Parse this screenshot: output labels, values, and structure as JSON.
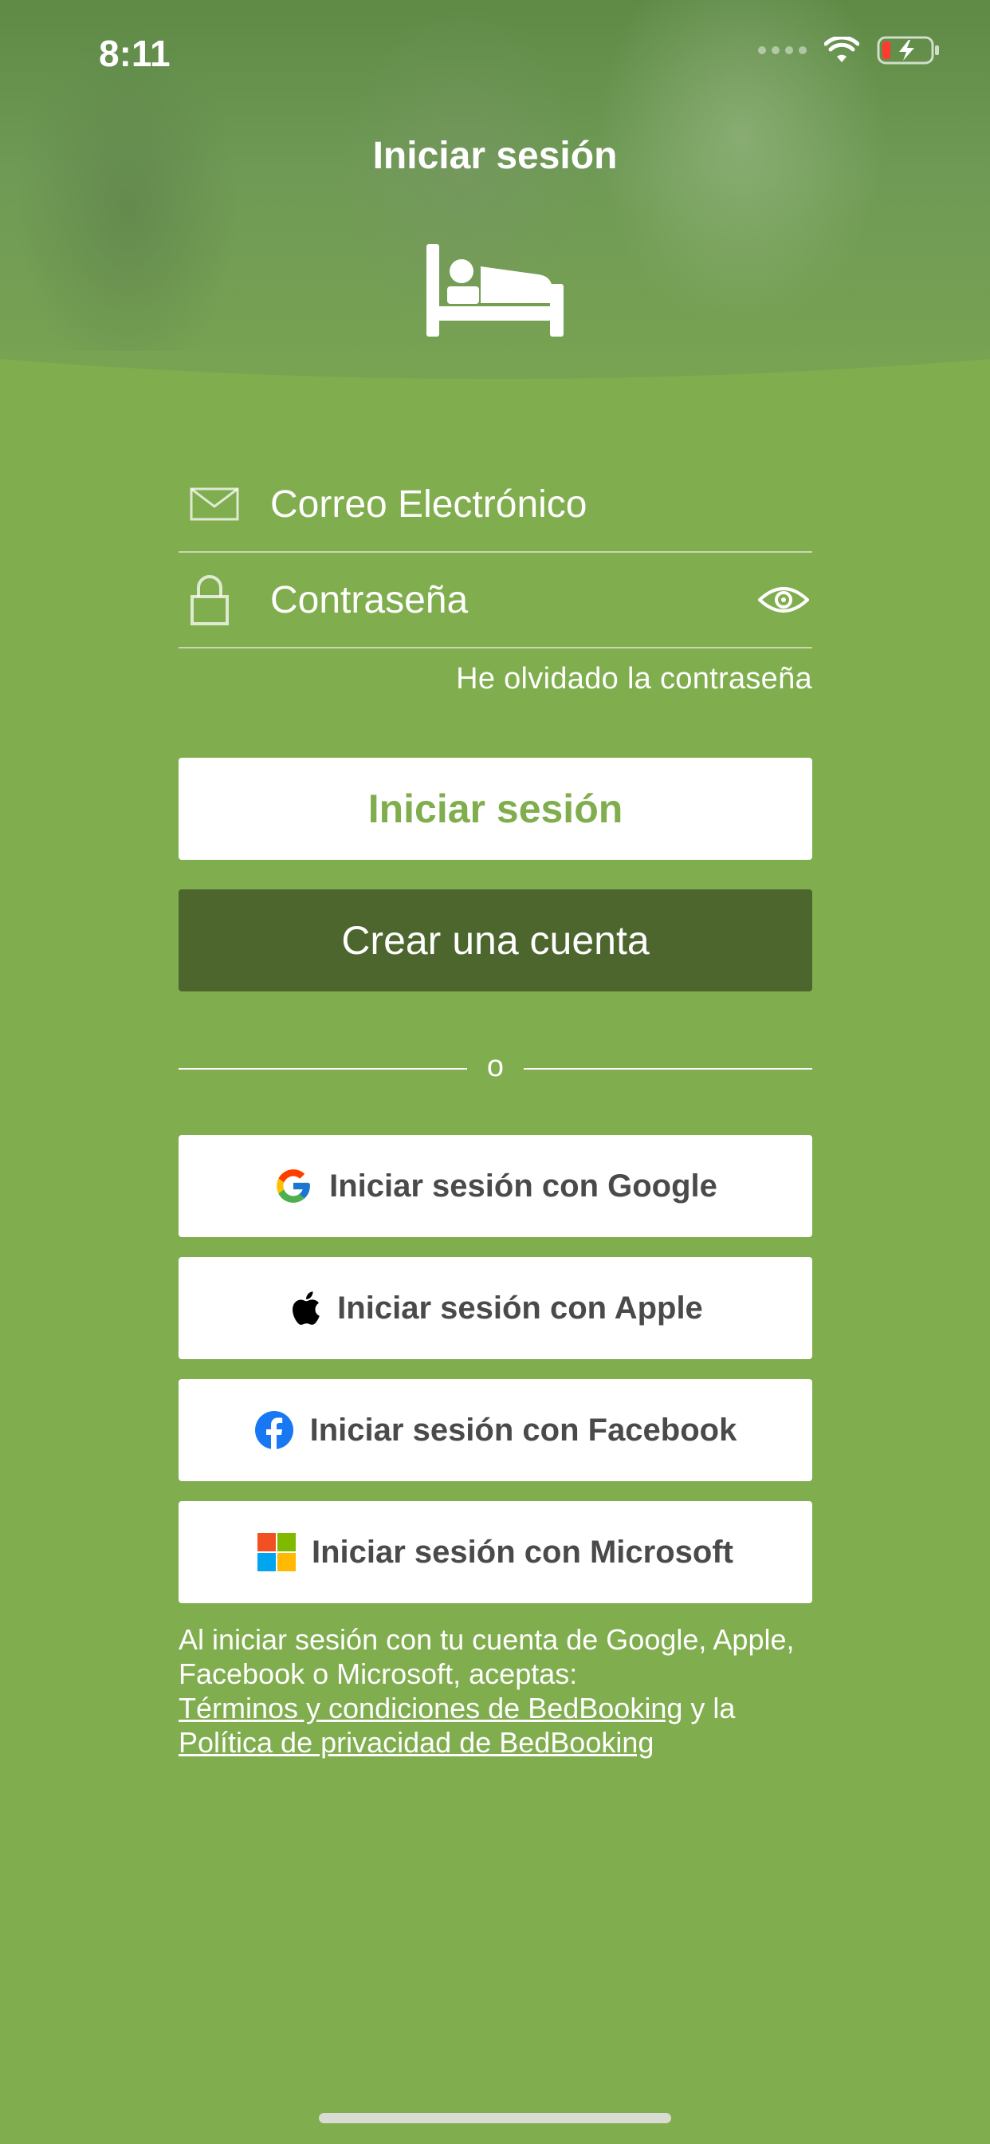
{
  "status_bar": {
    "time": "8:11"
  },
  "header": {
    "title": "Iniciar sesión"
  },
  "form": {
    "email_placeholder": "Correo Electrónico",
    "password_placeholder": "Contraseña",
    "forgot_password": "He olvidado la contraseña"
  },
  "buttons": {
    "login": "Iniciar sesión",
    "create_account": "Crear una cuenta"
  },
  "divider_text": "o",
  "social": {
    "google": "Iniciar sesión con Google",
    "apple": "Iniciar sesión con Apple",
    "facebook": "Iniciar sesión con Facebook",
    "microsoft": "Iniciar sesión con Microsoft"
  },
  "legal": {
    "text_part1": "Al iniciar sesión con tu cuenta de Google, Apple, Facebook o Microsoft, aceptas:",
    "terms_link": "Términos y condiciones de BedBooking",
    "and_text": "y la",
    "privacy_link": "Política de privacidad de BedBooking"
  },
  "colors": {
    "brand_green": "#80ad4d",
    "dark_green": "#4c662d",
    "button_text": "#4a4a4a"
  },
  "icons": [
    "bed-icon",
    "mail-icon",
    "lock-icon",
    "eye-icon",
    "google-icon",
    "apple-icon",
    "facebook-icon",
    "microsoft-icon",
    "wifi-icon",
    "battery-icon"
  ]
}
